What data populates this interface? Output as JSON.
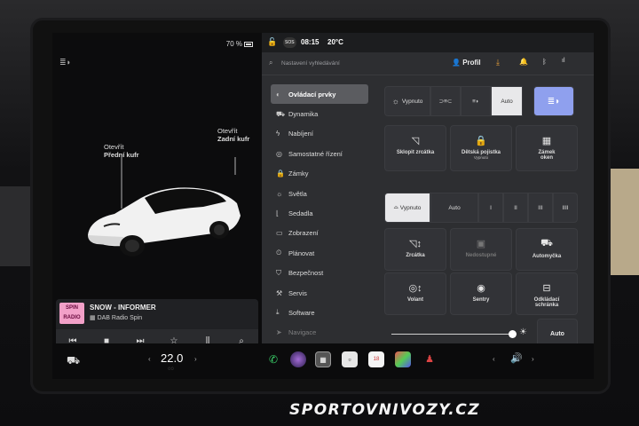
{
  "left": {
    "battery": "70 %",
    "front_trunk": [
      "Otevřít",
      "Přední kufr"
    ],
    "rear_trunk": [
      "Otevřít",
      "Zadní kufr"
    ]
  },
  "media": {
    "art_text": [
      "SPIN",
      "RADIO"
    ],
    "title": "SNOW - INFORMER",
    "subtitle": "DAB Radio Spin"
  },
  "topbar": {
    "sos": "SOS",
    "time": "08:15",
    "temp": "20°C",
    "search_placeholder": "Nastavení vyhledávání",
    "profile": "Profil"
  },
  "menu": [
    {
      "label": "Ovládací prvky",
      "icon": "toggle-icon",
      "glyph": "◐",
      "active": true
    },
    {
      "label": "Dynamika",
      "icon": "car-icon",
      "glyph": "⛟"
    },
    {
      "label": "Nabíjení",
      "icon": "bolt-icon",
      "glyph": "ϟ"
    },
    {
      "label": "Samostatné řízení",
      "icon": "steering-icon",
      "glyph": "◎"
    },
    {
      "label": "Zámky",
      "icon": "lock-icon",
      "glyph": "🔒"
    },
    {
      "label": "Světla",
      "icon": "light-icon",
      "glyph": "☼"
    },
    {
      "label": "Sedadla",
      "icon": "seat-icon",
      "glyph": "⌊"
    },
    {
      "label": "Zobrazení",
      "icon": "display-icon",
      "glyph": "▭"
    },
    {
      "label": "Plánovat",
      "icon": "clock-icon",
      "glyph": "⏲"
    },
    {
      "label": "Bezpečnost",
      "icon": "shield-icon",
      "glyph": "⛉"
    },
    {
      "label": "Servis",
      "icon": "wrench-icon",
      "glyph": "⚒"
    },
    {
      "label": "Software",
      "icon": "download-icon",
      "glyph": "⤓"
    },
    {
      "label": "Navigace",
      "icon": "navigation-icon",
      "glyph": "➤"
    }
  ],
  "lights": {
    "off": "Vypnuto",
    "auto": "Auto"
  },
  "tiles_row1": [
    {
      "label": "Sklopit zrcátka",
      "sub": "",
      "icon": "mirror-icon",
      "glyph": "◹"
    },
    {
      "label": "Dětská pojistka",
      "sub": "Vypnuto",
      "icon": "child-lock-icon",
      "glyph": "🔒"
    },
    {
      "label": "Zámek",
      "label2": "oken",
      "sub": "",
      "icon": "window-lock-icon",
      "glyph": "▦"
    }
  ],
  "wipers": {
    "off": "Vypnuto",
    "auto": "Auto",
    "levels": [
      "I",
      "II",
      "III",
      "IIII"
    ]
  },
  "tiles_row2": [
    {
      "label": "Zrcátka",
      "icon": "mirror-adjust-icon",
      "glyph": "◹↕",
      "disabled": false
    },
    {
      "label": "Nedostupné",
      "icon": "unavailable-icon",
      "glyph": "▣",
      "disabled": true
    },
    {
      "label": "Automyčka",
      "icon": "car-wash-icon",
      "glyph": "⛟",
      "disabled": false
    }
  ],
  "tiles_row3": [
    {
      "label": "Volant",
      "icon": "steering-adjust-icon",
      "glyph": "◎↕"
    },
    {
      "label": "Sentry",
      "icon": "sentry-icon",
      "glyph": "◉"
    },
    {
      "label": "Odkládací",
      "label2": "schránka",
      "icon": "glovebox-icon",
      "glyph": "⊟"
    }
  ],
  "brightness_auto": "Auto",
  "taskbar": {
    "temperature": "22.0"
  },
  "watermark": "SPORTOVNIVOZY.CZ"
}
